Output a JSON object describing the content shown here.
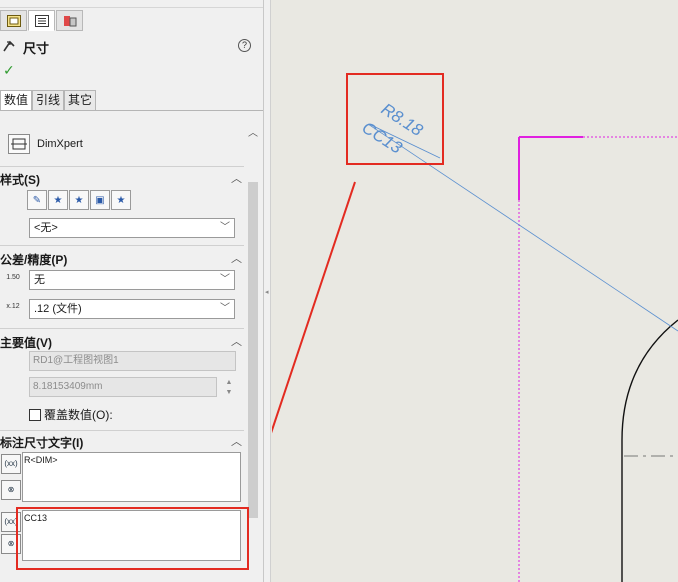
{
  "panel": {
    "title": "尺寸",
    "help_label": "?",
    "subtabs": [
      "数值",
      "引线",
      "其它"
    ],
    "dimxpert_label": "DimXpert",
    "sections": {
      "style": "样式(S)",
      "tolerance": "公差/精度(P)",
      "primary": "主要值(V)",
      "dim_text": "标注尺寸文字(I)"
    },
    "style_select": "<无>",
    "tol_type_value": "无",
    "precision_value": ".12 (文件)",
    "tol_icon_text": "1.50",
    "prec_icon_text": "x.12",
    "primary_name": "RD1@工程图视图1",
    "primary_value": "8.18153409mm",
    "override_label": "覆盖数值(O):",
    "dim_text_value": "R<DIM>",
    "dim_text_below": "CC13",
    "side_btn_label": "(xx)"
  },
  "drawing": {
    "dim_upper": "R8.18",
    "dim_lower": "CC13"
  },
  "colors": {
    "highlight": "#e32b21",
    "dimension": "#5a8fcf",
    "magenta": "#e020e0"
  }
}
